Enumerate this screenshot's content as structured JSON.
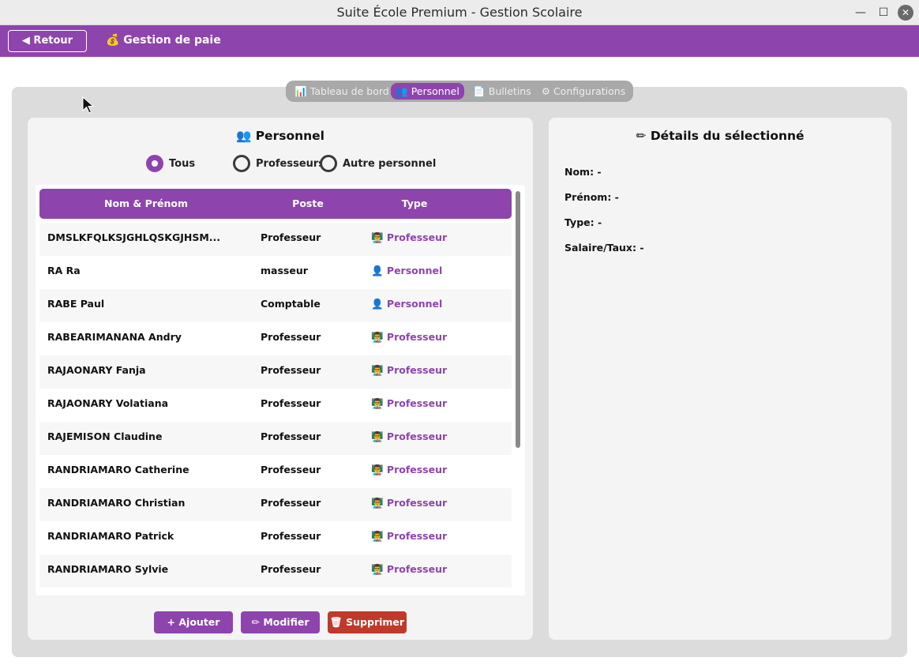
{
  "window": {
    "title": "Suite École Premium - Gestion Scolaire",
    "minimize": "—",
    "maximize": "☐",
    "close": "✕"
  },
  "header": {
    "back_label": "◀ Retour",
    "title": "💰 Gestion de paie"
  },
  "tabs": [
    {
      "label": "📊 Tableau de bord",
      "active": false
    },
    {
      "label": "👥 Personnel",
      "active": true
    },
    {
      "label": "📄 Bulletins",
      "active": false
    },
    {
      "label": "⚙ Configurations",
      "active": false
    }
  ],
  "personnel": {
    "title": "👥 Personnel",
    "filters": [
      {
        "label": "Tous",
        "checked": true
      },
      {
        "label": "Professeurs",
        "checked": false
      },
      {
        "label": "Autre personnel",
        "checked": false
      }
    ],
    "columns": [
      "Nom & Prénom",
      "Poste",
      "Type"
    ],
    "rows": [
      {
        "name": "DMSLKFQLKSJGHLQSKGJHSM...",
        "poste": "Professeur",
        "type": "👨‍🏫 Professeur"
      },
      {
        "name": "RA Ra",
        "poste": "masseur",
        "type": "👤 Personnel"
      },
      {
        "name": "RABE Paul",
        "poste": "Comptable",
        "type": "👤 Personnel"
      },
      {
        "name": "RABEARIMANANA Andry",
        "poste": "Professeur",
        "type": "👨‍🏫 Professeur"
      },
      {
        "name": "RAJAONARY Fanja",
        "poste": "Professeur",
        "type": "👨‍🏫 Professeur"
      },
      {
        "name": "RAJAONARY Volatiana",
        "poste": "Professeur",
        "type": "👨‍🏫 Professeur"
      },
      {
        "name": "RAJEMISON Claudine",
        "poste": "Professeur",
        "type": "👨‍🏫 Professeur"
      },
      {
        "name": "RANDRIAMARO Catherine",
        "poste": "Professeur",
        "type": "👨‍🏫 Professeur"
      },
      {
        "name": "RANDRIAMARO Christian",
        "poste": "Professeur",
        "type": "👨‍🏫 Professeur"
      },
      {
        "name": "RANDRIAMARO Patrick",
        "poste": "Professeur",
        "type": "👨‍🏫 Professeur"
      },
      {
        "name": "RANDRIAMARO Sylvie",
        "poste": "Professeur",
        "type": "👨‍🏫 Professeur"
      }
    ],
    "actions": {
      "add": "+ Ajouter",
      "edit": "✏ Modifier",
      "delete": "🗑 Supprimer"
    }
  },
  "details": {
    "title": "✏ Détails du sélectionné",
    "nom": "Nom: -",
    "prenom": "Prénom: -",
    "type": "Type: -",
    "salaire": "Salaire/Taux: -"
  },
  "colors": {
    "accent": "#8e44ad",
    "danger": "#c0392b",
    "panel": "#dcdcdc",
    "card": "#f4f4f4"
  }
}
